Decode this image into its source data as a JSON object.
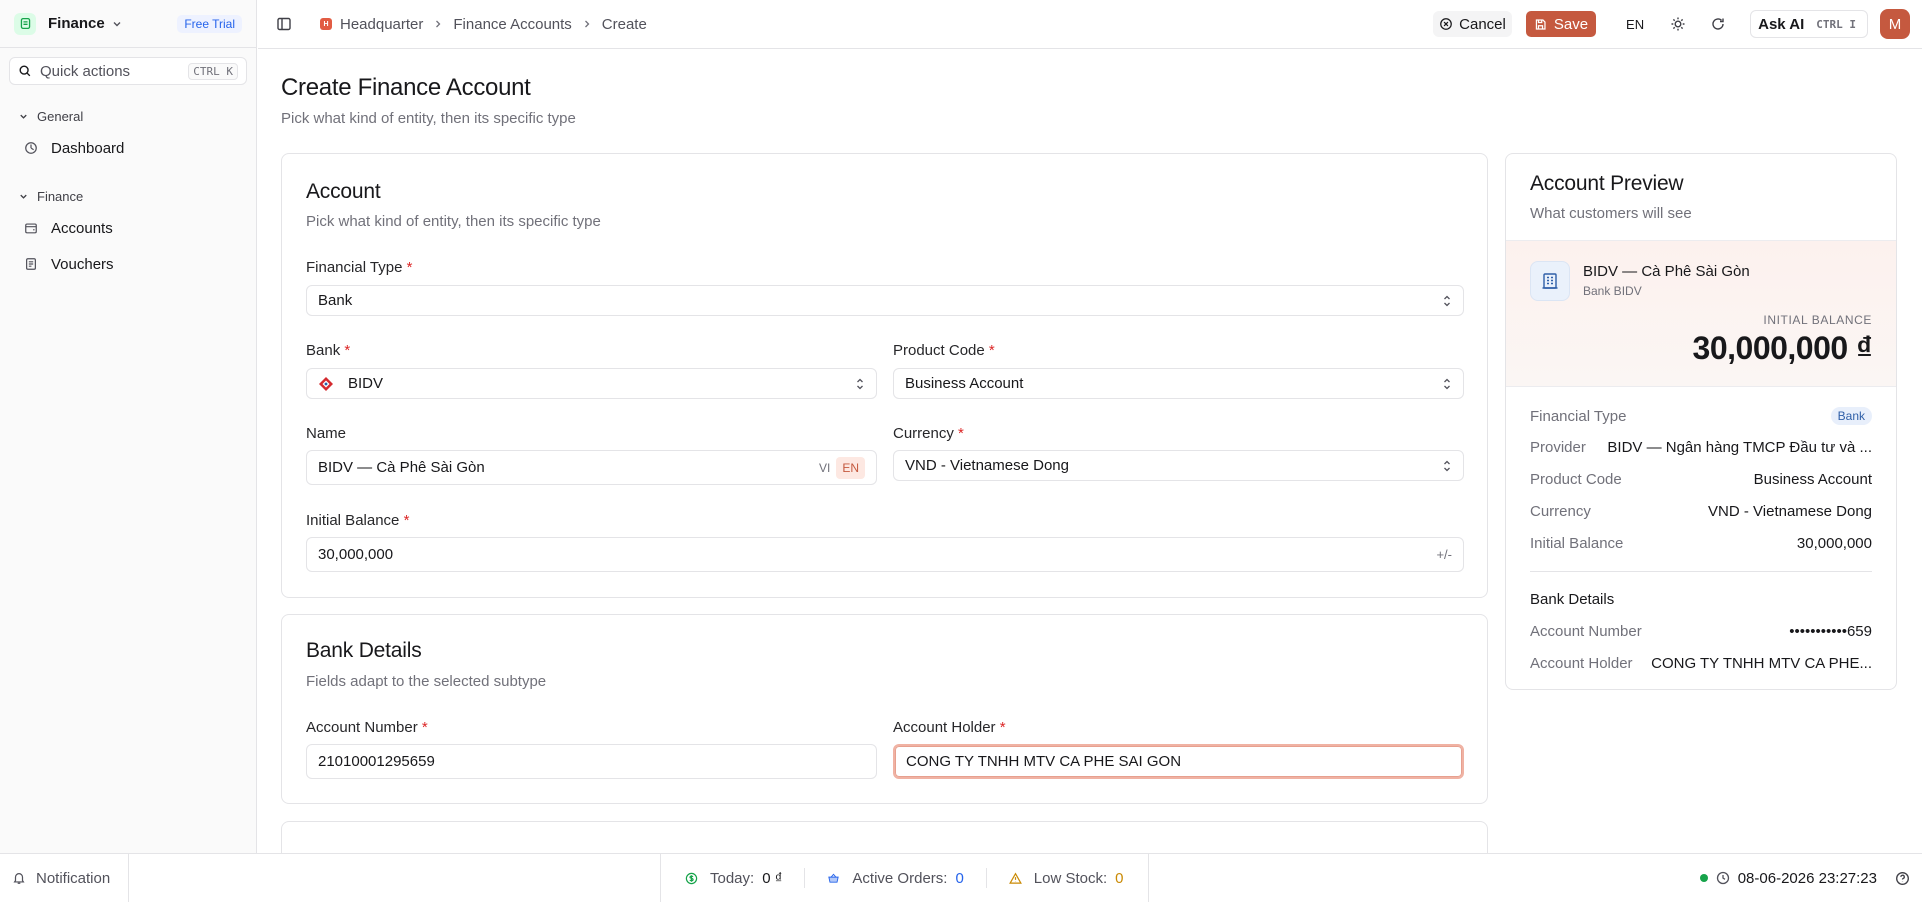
{
  "app": {
    "name": "Finance",
    "trial_badge": "Free Trial"
  },
  "sidebar": {
    "quick_actions": {
      "label": "Quick actions",
      "shortcut": "CTRL K"
    },
    "groups": [
      {
        "label": "General",
        "items": [
          {
            "label": "Dashboard",
            "icon": "gauge-icon"
          }
        ]
      },
      {
        "label": "Finance",
        "items": [
          {
            "label": "Accounts",
            "icon": "wallet-icon"
          },
          {
            "label": "Vouchers",
            "icon": "document-icon"
          }
        ]
      }
    ]
  },
  "topbar": {
    "breadcrumb": [
      "Headquarter",
      "Finance Accounts",
      "Create"
    ],
    "cancel_label": "Cancel",
    "save_label": "Save",
    "language": "EN",
    "ask_ai": {
      "label": "Ask AI",
      "shortcut": "CTRL I"
    },
    "avatar_initial": "M"
  },
  "page": {
    "title": "Create Finance Account",
    "subtitle": "Pick what kind of entity, then its specific type"
  },
  "account_card": {
    "title": "Account",
    "subtitle": "Pick what kind of entity, then its specific type",
    "financial_type": {
      "label": "Financial Type",
      "value": "Bank"
    },
    "bank": {
      "label": "Bank",
      "value": "BIDV"
    },
    "product_code": {
      "label": "Product Code",
      "value": "Business Account"
    },
    "name": {
      "label": "Name",
      "value": "BIDV — Cà Phê Sài Gòn",
      "lang_options": [
        "VI",
        "EN"
      ],
      "active_lang": "EN"
    },
    "currency": {
      "label": "Currency",
      "value": "VND - Vietnamese Dong"
    },
    "initial_balance": {
      "label": "Initial Balance",
      "value": "30,000,000",
      "suffix": "+/-"
    },
    "required_mark": "*"
  },
  "bank_details_card": {
    "title": "Bank Details",
    "subtitle": "Fields adapt to the selected subtype",
    "account_number": {
      "label": "Account Number",
      "value": "21010001295659"
    },
    "account_holder": {
      "label": "Account Holder",
      "value": "CONG TY TNHH MTV CA PHE SAI GON"
    }
  },
  "preview": {
    "title": "Account Preview",
    "subtitle": "What customers will see",
    "account_name": "BIDV — Cà Phê Sài Gòn",
    "bank_name": "Bank BIDV",
    "initial_balance_label": "INITIAL BALANCE",
    "initial_balance": "30,000,000 ₫",
    "rows": [
      {
        "key": "Financial Type",
        "value": "Bank"
      },
      {
        "key": "Provider",
        "value": "BIDV — Ngân hàng TMCP Đầu tư và ..."
      },
      {
        "key": "Product Code",
        "value": "Business Account"
      },
      {
        "key": "Currency",
        "value": "VND - Vietnamese Dong"
      },
      {
        "key": "Initial Balance",
        "value": "30,000,000"
      }
    ],
    "bank_details_title": "Bank Details",
    "bank_rows": [
      {
        "key": "Account Number",
        "value": "•••••••••••659"
      },
      {
        "key": "Account Holder",
        "value": "CONG TY TNHH MTV CA PHE..."
      }
    ]
  },
  "bottombar": {
    "notification_label": "Notification",
    "stats": [
      {
        "label": "Today:",
        "value": "0 ₫",
        "icon": "dollar-circle-icon",
        "value_color": "#18181b"
      },
      {
        "label": "Active Orders:",
        "value": "0",
        "icon": "basket-icon",
        "value_color": "#2563eb"
      },
      {
        "label": "Low Stock:",
        "value": "0",
        "icon": "warning-icon",
        "value_color": "#ca8a04"
      }
    ],
    "datetime": "08-06-2026 23:27:23"
  },
  "colors": {
    "accent": "#c5593f",
    "online": "#16a34a",
    "link": "#2563eb"
  }
}
